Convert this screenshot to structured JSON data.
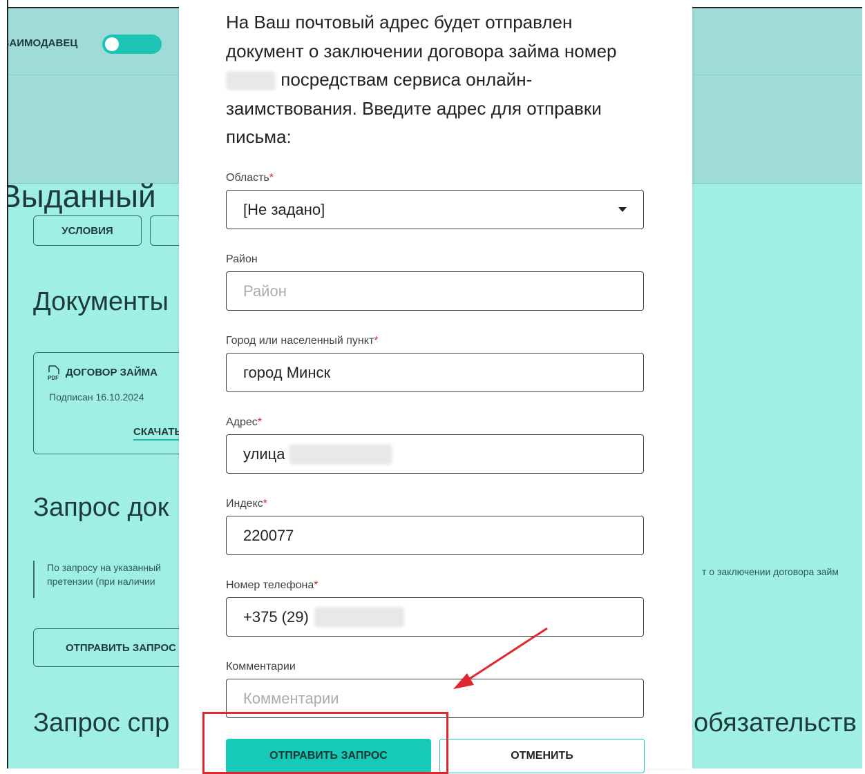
{
  "background": {
    "header": {
      "toggle_label": "ЗАИМОДАВЕЦ"
    },
    "hero_title": "Выданный",
    "tabs": [
      {
        "label": "УСЛОВИЯ"
      },
      {
        "label": ""
      }
    ],
    "documents_heading": "Документы",
    "document_card": {
      "title": "ДОГОВОР ЗАЙМА",
      "signed": "Подписан 16.10.2024",
      "download": "СКАЧАТЬ"
    },
    "request_heading": "Запрос док",
    "note_line1": "По запросу на указанный",
    "note_line2": "претензии (при наличии",
    "note_right": "т о заключении договора займ",
    "send_request": "ОТПРАВИТЬ ЗАПРОС",
    "certificate_heading_left": "Запрос спр",
    "certificate_heading_right": "обязательств"
  },
  "modal": {
    "intro_part1": "На Ваш почтовый адрес будет отправлен документ о заключении договора займа номер",
    "intro_part2": "посредствам сервиса онлайн-заимствования. Введите адрес для отправки письма:",
    "fields": {
      "region": {
        "label": "Область",
        "required": "*",
        "value": "[Не задано]"
      },
      "district": {
        "label": "Район",
        "placeholder": "Район"
      },
      "city": {
        "label": "Город или населенный пункт",
        "required": "*",
        "value": "город Минск"
      },
      "address": {
        "label": "Адрес",
        "required": "*",
        "value": "улица"
      },
      "index": {
        "label": "Индекс",
        "required": "*",
        "value": "220077"
      },
      "phone": {
        "label": "Номер телефона",
        "required": "*",
        "value": "+375 (29)"
      },
      "comments": {
        "label": "Комментарии",
        "placeholder": "Комментарии"
      }
    },
    "buttons": {
      "submit": "ОТПРАВИТЬ ЗАПРОС",
      "cancel": "ОТМЕНИТЬ"
    }
  },
  "colors": {
    "accent": "#17c9b8",
    "background": "#a0efe5",
    "annotation": "#e0262e"
  }
}
